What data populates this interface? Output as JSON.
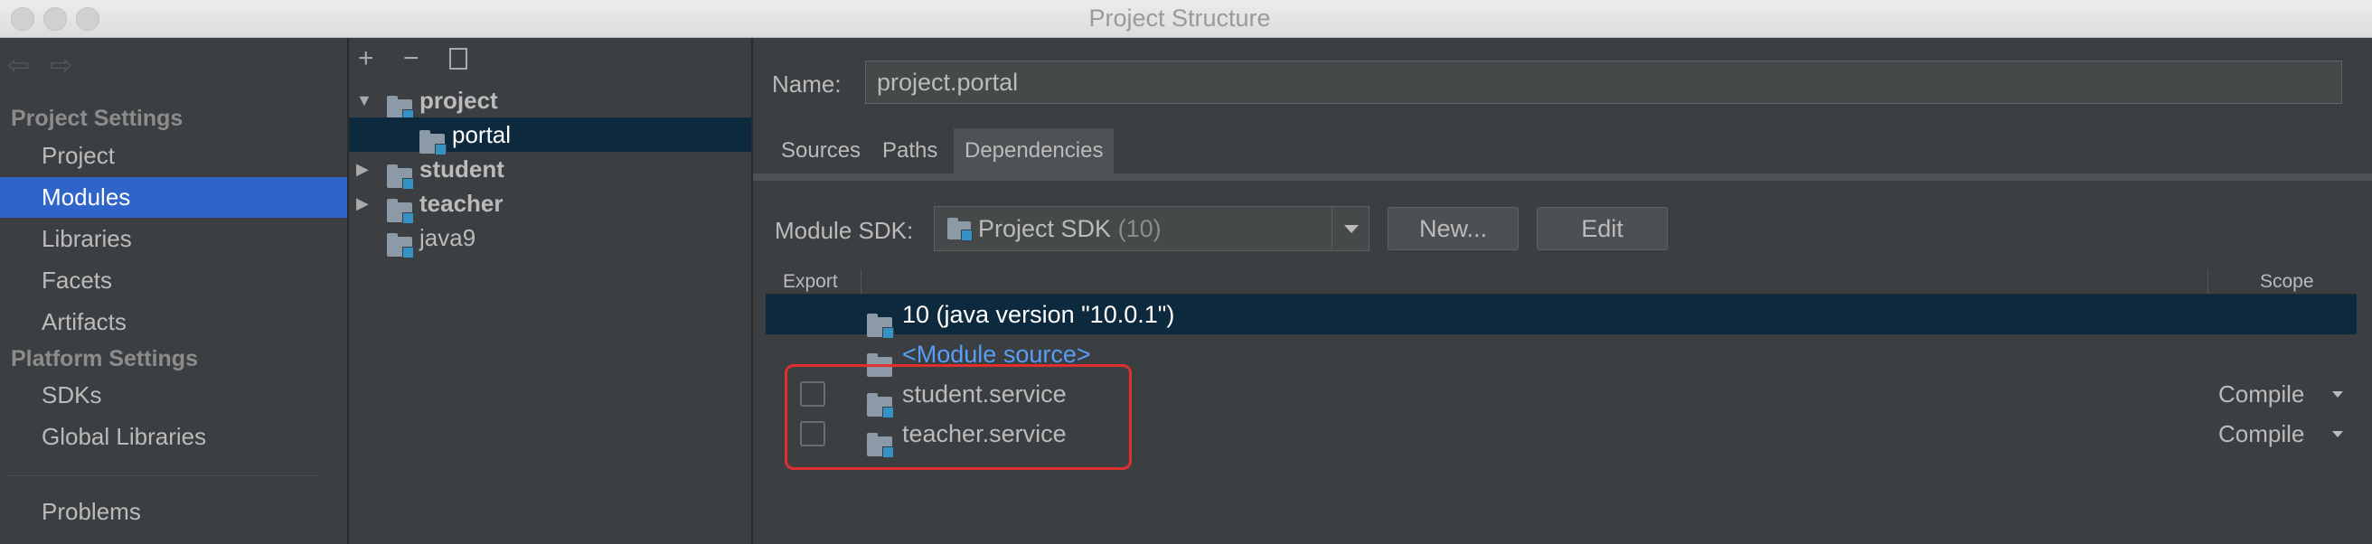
{
  "window": {
    "title": "Project Structure"
  },
  "sidebar": {
    "project_settings_header": "Project Settings",
    "project_items": [
      "Project",
      "Modules",
      "Libraries",
      "Facets",
      "Artifacts"
    ],
    "platform_settings_header": "Platform Settings",
    "platform_items": [
      "SDKs",
      "Global Libraries"
    ],
    "problems": "Problems",
    "selected": "Modules"
  },
  "module_tree": {
    "toolbar": {
      "add": "+",
      "remove": "−"
    },
    "nodes": [
      "project",
      "portal",
      "student",
      "teacher",
      "java9"
    ],
    "selected": "portal"
  },
  "module_detail": {
    "name_label": "Name:",
    "name_value": "project.portal",
    "tabs": [
      "Sources",
      "Paths",
      "Dependencies"
    ],
    "active_tab": "Dependencies",
    "sdk_label": "Module SDK:",
    "sdk_value": "Project SDK",
    "sdk_version": "(10)",
    "new_button": "New...",
    "edit_button": "Edit"
  },
  "dependencies": {
    "columns": {
      "export": "Export",
      "scope": "Scope"
    },
    "rows": [
      {
        "name": "10 (java version \"10.0.1\")"
      },
      {
        "name": "<Module source>"
      },
      {
        "name": "student.service",
        "scope": "Compile"
      },
      {
        "name": "teacher.service",
        "scope": "Compile"
      }
    ]
  },
  "colors": {
    "selection_blue": "#2f65ca",
    "tree_selection": "#0d293e",
    "highlight_red": "#e02f2f",
    "link_blue": "#589df6"
  }
}
